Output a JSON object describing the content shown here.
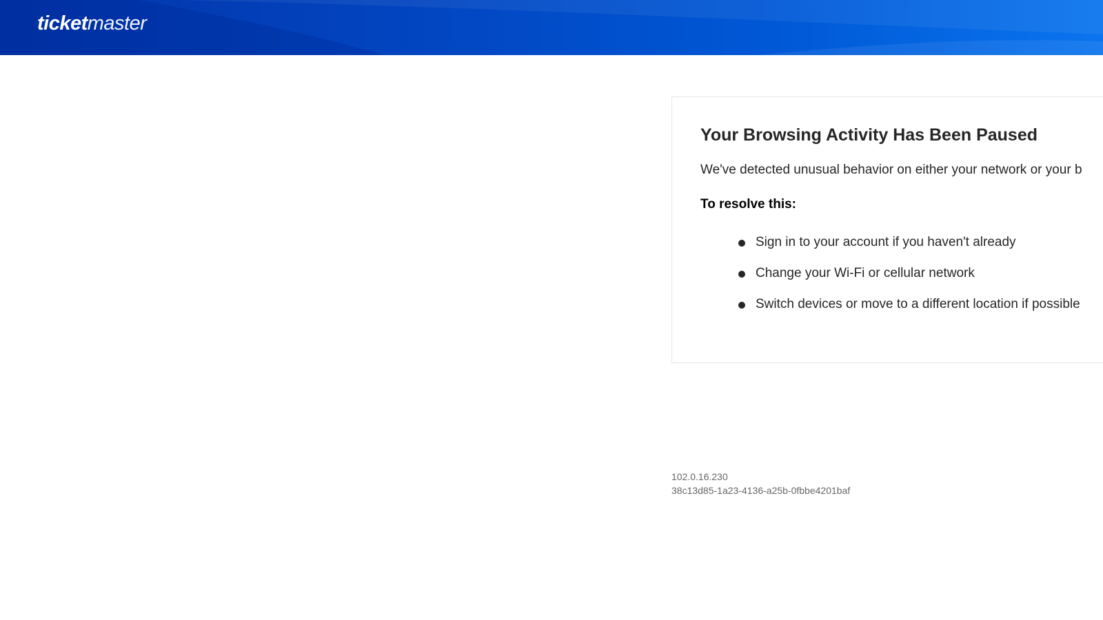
{
  "header": {
    "logo_bold": "ticket",
    "logo_light": "master",
    "colors": {
      "gradient_start": "#0134a8",
      "gradient_end": "#0a74ee"
    }
  },
  "notice": {
    "title": "Your Browsing Activity Has Been Paused",
    "description": "We've detected unusual behavior on either your network or your b",
    "resolve_heading": "To resolve this:",
    "steps": [
      "Sign in to your account if you haven't already",
      "Change your Wi-Fi or cellular network",
      "Switch devices or move to a different location if possible"
    ]
  },
  "footer": {
    "ip_address": "102.0.16.230",
    "request_id": "38c13d85-1a23-4136-a25b-0fbbe4201baf"
  }
}
